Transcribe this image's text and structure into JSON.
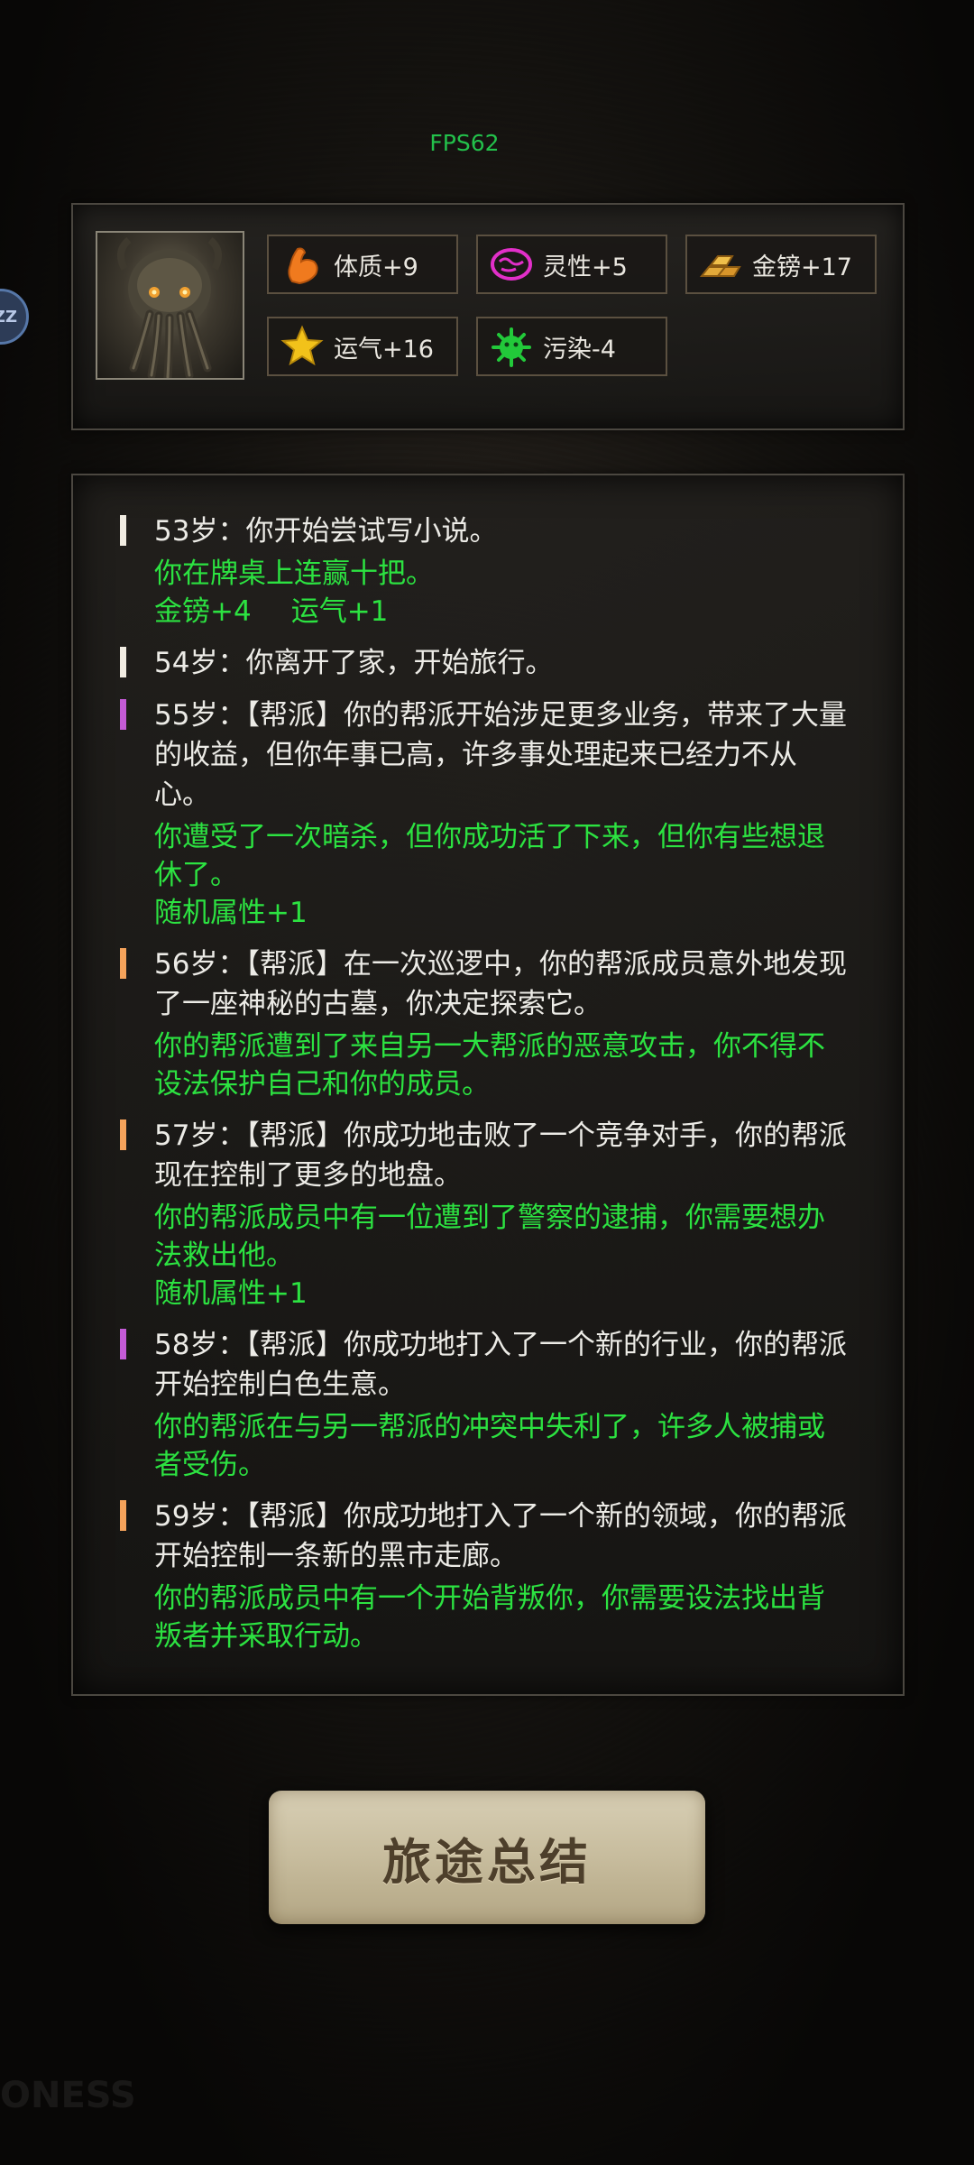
{
  "hud": {
    "fps": "FPS62",
    "side_badge": "ZZ"
  },
  "stats": [
    {
      "id": "constitution",
      "label": "体质+9",
      "icon": "muscle-arm-icon",
      "color": "#f07a1e"
    },
    {
      "id": "spirit",
      "label": "灵性+5",
      "icon": "brain-icon",
      "color": "#e22fc9"
    },
    {
      "id": "gold",
      "label": "金镑+17",
      "icon": "gold-bars-icon",
      "color": "#d39a2a"
    },
    {
      "id": "luck",
      "label": "运气+16",
      "icon": "star-icon",
      "color": "#f2c21a"
    },
    {
      "id": "pollution",
      "label": "污染-4",
      "icon": "germ-icon",
      "color": "#22c93a"
    }
  ],
  "log": [
    {
      "bar_color": "#f1ece2",
      "main": "53岁：你开始尝试写小说。",
      "sub": "你在牌桌上连赢十把。",
      "attrs": [
        "金镑+4",
        "运气+1"
      ]
    },
    {
      "bar_color": "#f1ece2",
      "main": "54岁：你离开了家，开始旅行。",
      "sub": "",
      "attrs": []
    },
    {
      "bar_color": "#c45bd6",
      "main": "55岁：【帮派】你的帮派开始涉足更多业务，带来了大量的收益，但你年事已高，许多事处理起来已经力不从心。",
      "sub": "你遭受了一次暗杀，但你成功活了下来，但你有些想退休了。",
      "attrs": [
        "随机属性+1"
      ]
    },
    {
      "bar_color": "#f5a35b",
      "main": "56岁：【帮派】在一次巡逻中，你的帮派成员意外地发现了一座神秘的古墓，你决定探索它。",
      "sub": "你的帮派遭到了来自另一大帮派的恶意攻击，你不得不设法保护自己和你的成员。",
      "attrs": []
    },
    {
      "bar_color": "#f5a35b",
      "main": "57岁：【帮派】你成功地击败了一个竞争对手，你的帮派现在控制了更多的地盘。",
      "sub": "你的帮派成员中有一位遭到了警察的逮捕，你需要想办法救出他。",
      "attrs": [
        "随机属性+1"
      ]
    },
    {
      "bar_color": "#c45bd6",
      "main": "58岁：【帮派】你成功地打入了一个新的行业，你的帮派开始控制白色生意。",
      "sub": "你的帮派在与另一帮派的冲突中失利了，许多人被捕或者受伤。",
      "attrs": []
    },
    {
      "bar_color": "#f5a35b",
      "main": "59岁：【帮派】你成功地打入了一个新的领域，你的帮派开始控制一条新的黑市走廊。",
      "sub": "你的帮派成员中有一个开始背叛你，你需要设法找出背叛者并采取行动。",
      "attrs": []
    }
  ],
  "button": {
    "summary": "旅途总结"
  },
  "watermark": "ONESS"
}
